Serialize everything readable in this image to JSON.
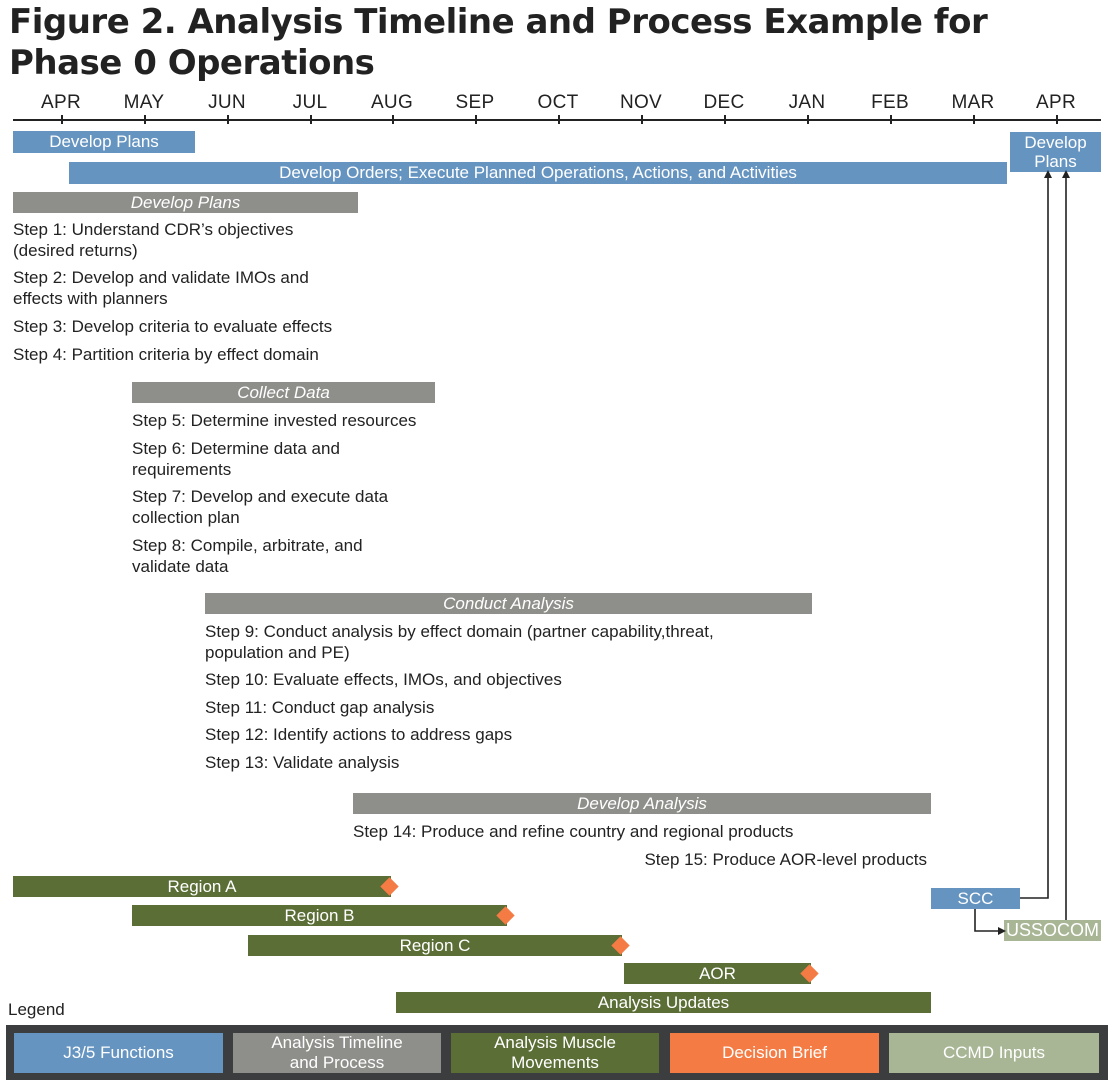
{
  "title": {
    "line1": "Figure 2. Analysis Timeline and Process Example for",
    "line2": "Phase 0 Operations"
  },
  "timeline": {
    "months": [
      "APR",
      "MAY",
      "JUN",
      "JUL",
      "AUG",
      "SEP",
      "OCT",
      "NOV",
      "DEC",
      "JAN",
      "FEB",
      "MAR",
      "APR"
    ]
  },
  "j35": {
    "develop_plans": "Develop Plans",
    "develop_orders": "Develop Orders; Execute Planned Operations, Actions, and Activities",
    "develop_plans_next_line1": "Develop",
    "develop_plans_next_line2": "Plans"
  },
  "phases": [
    {
      "label": "Develop Plans",
      "steps": [
        "Step 1: Understand CDR’s objectives (desired returns)",
        "Step 2: Develop and validate IMOs and effects with planners",
        "Step 3: Develop criteria to evaluate effects",
        "Step 4: Partition criteria by effect domain"
      ]
    },
    {
      "label": "Collect Data",
      "steps": [
        "Step 5: Determine invested resources",
        "Step 6: Determine data and requirements",
        "Step 7: Develop and execute data collection plan",
        "Step 8: Compile, arbitrate, and validate data"
      ]
    },
    {
      "label": "Conduct Analysis",
      "steps": [
        "Step 9: Conduct analysis by effect domain (partner capability,threat, population and PE)",
        "Step 10: Evaluate effects, IMOs, and objectives",
        "Step 11: Conduct gap analysis",
        "Step 12: Identify actions to address gaps",
        "Step 13: Validate analysis"
      ]
    },
    {
      "label": "Develop Analysis",
      "steps": [
        "Step 14: Produce and refine country and regional products",
        "Step 15: Produce AOR-level products"
      ]
    }
  ],
  "muscle_movements": [
    {
      "label": "Region A",
      "decision_brief": true
    },
    {
      "label": "Region B",
      "decision_brief": true
    },
    {
      "label": "Region C",
      "decision_brief": true
    },
    {
      "label": "AOR",
      "decision_brief": true
    },
    {
      "label": "Analysis Updates",
      "decision_brief": false
    }
  ],
  "inputs": {
    "scc": "SCC",
    "ussocom": "USSOCOM"
  },
  "legend": {
    "title": "Legend",
    "items": [
      {
        "label": "J3/5 Functions",
        "color": "#6694c0"
      },
      {
        "label_line1": "Analysis Timeline",
        "label_line2": "and Process",
        "color": "#8e8e8a"
      },
      {
        "label_line1": "Analysis Muscle",
        "label_line2": "Movements",
        "color": "#5b6e36"
      },
      {
        "label": "Decision Brief",
        "color": "#f47c44"
      },
      {
        "label": "CCMD Inputs",
        "color": "#a8b696"
      }
    ]
  },
  "colors": {
    "j35": "#6694c0",
    "process": "#8e8e8a",
    "muscle": "#5b6e36",
    "decision": "#f47c44",
    "ccmd": "#a8b696",
    "legend_bg": "#3c3d3f"
  }
}
